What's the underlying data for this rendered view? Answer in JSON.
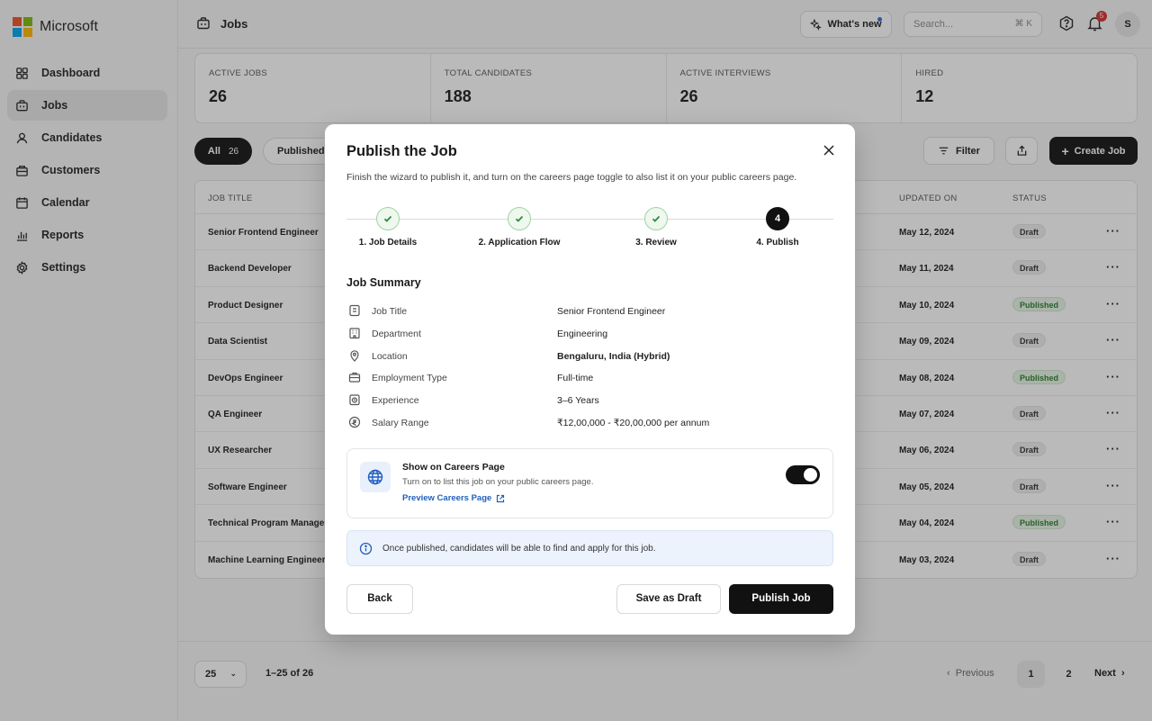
{
  "brand": {
    "name": "Microsoft"
  },
  "sidebar": {
    "items": [
      {
        "label": "Dashboard",
        "icon": "grid-icon"
      },
      {
        "label": "Jobs",
        "icon": "briefcase-icon",
        "active": true
      },
      {
        "label": "Candidates",
        "icon": "user-icon"
      },
      {
        "label": "Customers",
        "icon": "building-icon"
      },
      {
        "label": "Calendar",
        "icon": "calendar-icon"
      },
      {
        "label": "Reports",
        "icon": "chart-icon"
      },
      {
        "label": "Settings",
        "icon": "gear-icon"
      }
    ]
  },
  "topbar": {
    "title": "Jobs",
    "whats_new": "What's new",
    "search_placeholder": "Search...",
    "search_shortcut": "⌘ K",
    "notification_count": "5",
    "avatar_initial": "S"
  },
  "stats": [
    {
      "label": "ACTIVE JOBS",
      "value": "26"
    },
    {
      "label": "TOTAL CANDIDATES",
      "value": "188"
    },
    {
      "label": "ACTIVE INTERVIEWS",
      "value": "26"
    },
    {
      "label": "HIRED",
      "value": "12"
    }
  ],
  "filters": {
    "all_label": "All",
    "all_count": "26",
    "published_label": "Published",
    "filter_label": "Filter",
    "create_label": "Create Job"
  },
  "table": {
    "headers": {
      "title": "JOB TITLE",
      "updated": "UPDATED ON",
      "status": "STATUS"
    },
    "rows": [
      {
        "title": "Senior Frontend Engineer",
        "updated": "May 12, 2024",
        "status": "Draft"
      },
      {
        "title": "Backend Developer",
        "updated": "May 11, 2024",
        "status": "Draft"
      },
      {
        "title": "Product Designer",
        "updated": "May 10, 2024",
        "status": "Published"
      },
      {
        "title": "Data Scientist",
        "updated": "May 09, 2024",
        "status": "Draft"
      },
      {
        "title": "DevOps Engineer",
        "updated": "May 08, 2024",
        "status": "Published"
      },
      {
        "title": "QA Engineer",
        "updated": "May 07, 2024",
        "status": "Draft"
      },
      {
        "title": "UX Researcher",
        "updated": "May 06, 2024",
        "status": "Draft"
      },
      {
        "title": "Software Engineer",
        "updated": "May 05, 2024",
        "status": "Draft"
      },
      {
        "title": "Technical Program Manager",
        "updated": "May 04, 2024",
        "status": "Published"
      },
      {
        "title": "Machine Learning Engineer",
        "updated": "May 03, 2024",
        "status": "Draft"
      }
    ]
  },
  "pagination": {
    "per_page": "25",
    "range": "1–25 of 26",
    "previous": "Previous",
    "pages": [
      "1",
      "2"
    ],
    "next": "Next"
  },
  "modal": {
    "title": "Publish the Job",
    "subtitle": "Finish the wizard to publish it, and turn on the careers page toggle to also list it on your public careers page.",
    "steps": [
      {
        "label": "1. Job Details",
        "state": "done"
      },
      {
        "label": "2. Application Flow",
        "state": "done"
      },
      {
        "label": "3. Review",
        "state": "done"
      },
      {
        "label": "4. Publish",
        "state": "current",
        "number": "4"
      }
    ],
    "summary_title": "Job Summary",
    "summary": [
      {
        "label": "Job Title",
        "value": "Senior Frontend Engineer",
        "icon": "badge-icon"
      },
      {
        "label": "Department",
        "value": "Engineering",
        "icon": "building-icon"
      },
      {
        "label": "Location",
        "value": "Bengaluru, India (Hybrid)",
        "icon": "location-pin-icon"
      },
      {
        "label": "Employment Type",
        "value": "Full-time",
        "icon": "briefcase-icon"
      },
      {
        "label": "Experience",
        "value": "3–6 Years",
        "icon": "clock-icon"
      },
      {
        "label": "Salary Range",
        "value": "₹12,00,000 - ₹20,00,000 per annum",
        "icon": "salary-icon"
      }
    ],
    "careers": {
      "title": "Show on Careers Page",
      "description": "Turn on to list this job on your public careers page.",
      "link": "Preview Careers Page",
      "enabled": true
    },
    "info": "Once published, candidates will be able to find and apply for this job.",
    "buttons": {
      "back": "Back",
      "draft": "Save as Draft",
      "publish": "Publish Job"
    }
  },
  "colors": {
    "accent": "#111111",
    "link": "#1f5fbf",
    "success": "#2a7a2a",
    "badge": "#d32f2f"
  }
}
